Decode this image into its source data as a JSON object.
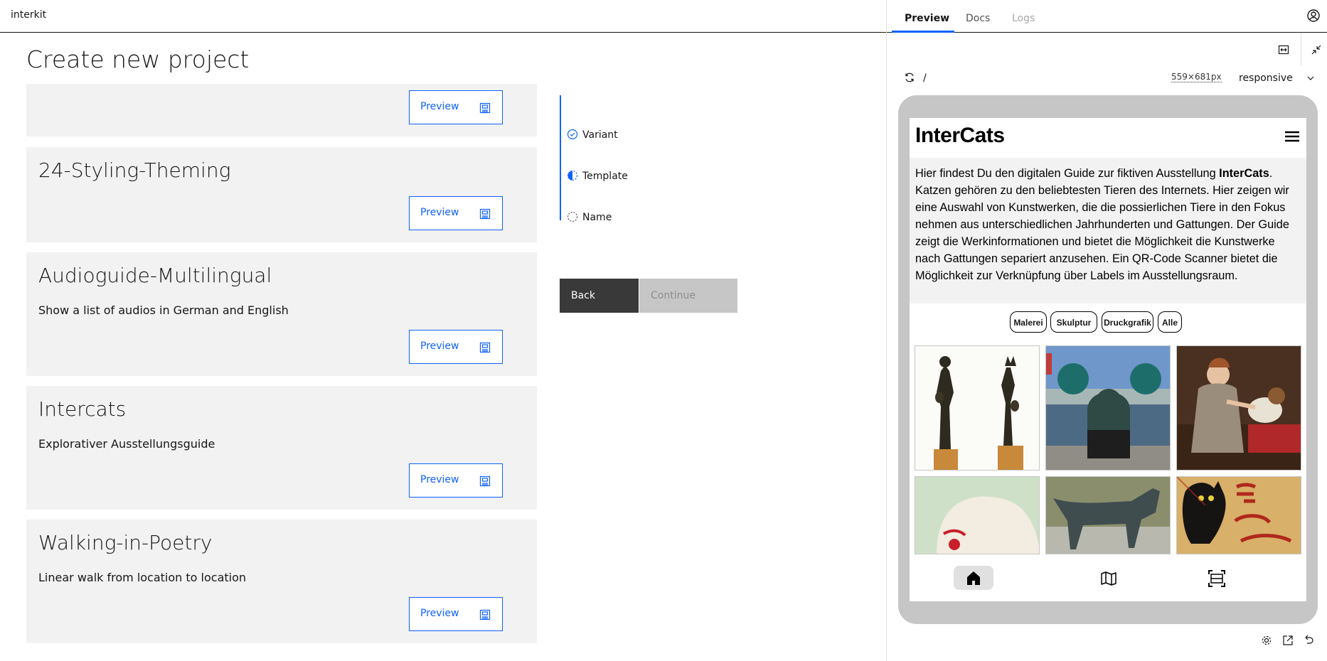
{
  "app": {
    "name": "interkit"
  },
  "page": {
    "title": "Create new project"
  },
  "tiles": [
    {
      "title": "",
      "description": "",
      "button_label": "Preview"
    },
    {
      "title": "24-Styling-Theming",
      "description": "",
      "button_label": "Preview"
    },
    {
      "title": "Audioguide-Multilingual",
      "description": "Show a list of audios in German and English",
      "button_label": "Preview"
    },
    {
      "title": "Intercats",
      "description": "Explorativer Ausstellungsguide",
      "button_label": "Preview"
    },
    {
      "title": "Walking-in-Poetry",
      "description": "Linear walk from location to location",
      "button_label": "Preview"
    }
  ],
  "steps": [
    {
      "label": "Variant",
      "state": "complete"
    },
    {
      "label": "Template",
      "state": "current"
    },
    {
      "label": "Name",
      "state": "incomplete"
    }
  ],
  "actions": {
    "back": "Back",
    "continue": "Continue"
  },
  "panel": {
    "tabs": [
      "Preview",
      "Docs",
      "Logs"
    ],
    "path": "/",
    "dimensions": "559×681px",
    "mode": "responsive"
  },
  "intercats": {
    "logo": "InterCats",
    "intro_before": "Hier findest Du den digitalen Guide zur fiktiven Ausstellung ",
    "intro_bold": "InterCats",
    "intro_after": ". Katzen gehören zu den beliebtesten Tieren des Internets. Hier zeigen wir eine Auswahl von Kunstwerken, die die possierlichen Tiere in den Fokus nehmen aus unterschiedlichen Jahrhunderten und Gattungen. Der Guide zeigt die Werkinformationen und bietet die Möglichkeit die Kunstwerke nach Gattungen separiert anzusehen. Ein QR-Code Scanner bietet die Möglichkeit zur Verknüpfung über Labels im Ausstellungsraum.",
    "filters": [
      "Malerei",
      "Skulptur",
      "Druckgrafik",
      "Alle"
    ]
  },
  "colors": {
    "accent": "#0f62fe",
    "dark_button": "#393939",
    "disabled_button": "#c6c6c6",
    "tile_bg": "#f2f2f2"
  }
}
